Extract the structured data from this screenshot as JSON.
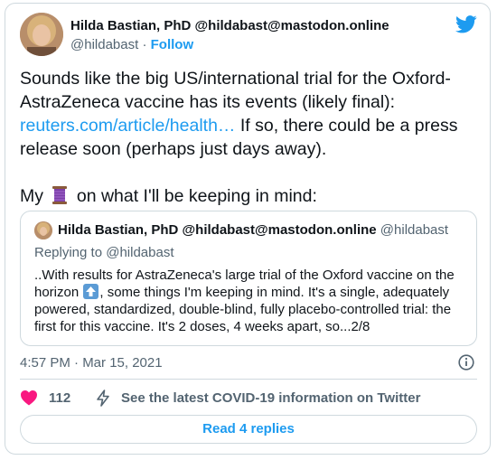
{
  "author": {
    "name": "Hilda Bastian, PhD @hildabast@mastodon.online",
    "handle": "@hildabast",
    "separator": "·",
    "follow_label": "Follow"
  },
  "tweet": {
    "line1": "Sounds like the big US/international trial for the Oxford-",
    "line2": "AstraZeneca vaccine has its events (likely final):",
    "link": "reuters.com/article/health…",
    "line3_rest": " If so, there could be a press",
    "line4": "release soon (perhaps just days away).",
    "line5_before": "My",
    "line5_after": "on what I'll be keeping in mind:",
    "thread_emoji": "thread-spool-icon"
  },
  "quoted": {
    "name": "Hilda Bastian, PhD @hildabast@mastodon.online",
    "handle": "@hildabast",
    "replying_to": "Replying to @hildabast",
    "text_part1": "..With results for AstraZeneca's large trial of the Oxford vaccine on the horizon",
    "text_part2": ", some things I'm keeping in mind. It's a single, adequately powered, standardized, double-blind, fully placebo-controlled trial: the first for this vaccine. It's 2 doses, 4 weeks apart, so...2/8"
  },
  "meta": {
    "timestamp": "4:57 PM · Mar 15, 2021"
  },
  "actions": {
    "like_count": "112",
    "covid_label": "See the latest COVID-19 information on Twitter",
    "read_replies": "Read 4 replies"
  },
  "colors": {
    "accent": "#1d9bf0",
    "like": "#f91880",
    "secondary_text": "#536471",
    "border": "#cfd9de"
  }
}
